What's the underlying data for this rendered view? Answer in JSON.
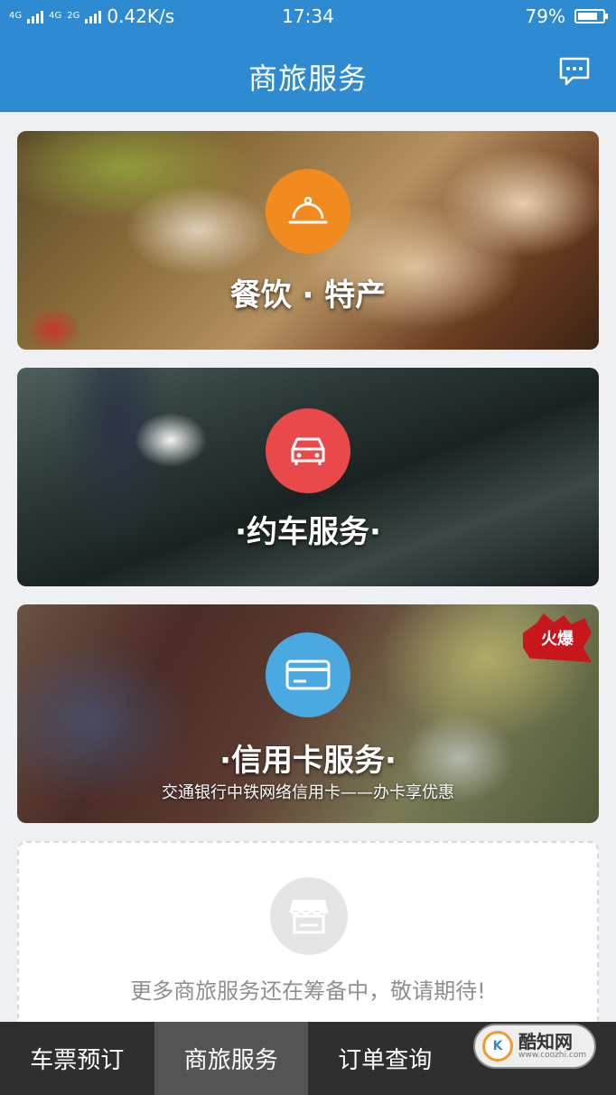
{
  "status_bar": {
    "network_left": "4G",
    "network_mid": "4G",
    "network_right": "2G",
    "speed": "0.42K/s",
    "time": "17:34",
    "battery": "79%",
    "battery_level": 0.79
  },
  "header": {
    "title": "商旅服务",
    "message_icon": "chat-bubble-icon"
  },
  "cards": [
    {
      "label": "餐饮 · 特产",
      "icon": "cloche-icon",
      "circle_color": "#f18a1f"
    },
    {
      "label": "·约车服务·",
      "icon": "car-icon",
      "circle_color": "#e9494a"
    },
    {
      "label": "·信用卡服务·",
      "subtitle": "交通银行中铁网络信用卡——办卡享优惠",
      "badge": "火爆",
      "icon": "credit-card-icon",
      "circle_color": "#49a9e0"
    }
  ],
  "more": {
    "icon": "storefront-icon",
    "text": "更多商旅服务还在筹备中，敬请期待!"
  },
  "tabs": [
    {
      "label": "车票预订",
      "active": false
    },
    {
      "label": "商旅服务",
      "active": true
    },
    {
      "label": "订单查询",
      "active": false
    }
  ],
  "watermark": {
    "text": "酷知网",
    "sub": "www.coozhi.com"
  },
  "colors": {
    "brand_blue": "#2e8ad1",
    "tabbar": "#2f2f2f",
    "tab_active": "#545454"
  }
}
